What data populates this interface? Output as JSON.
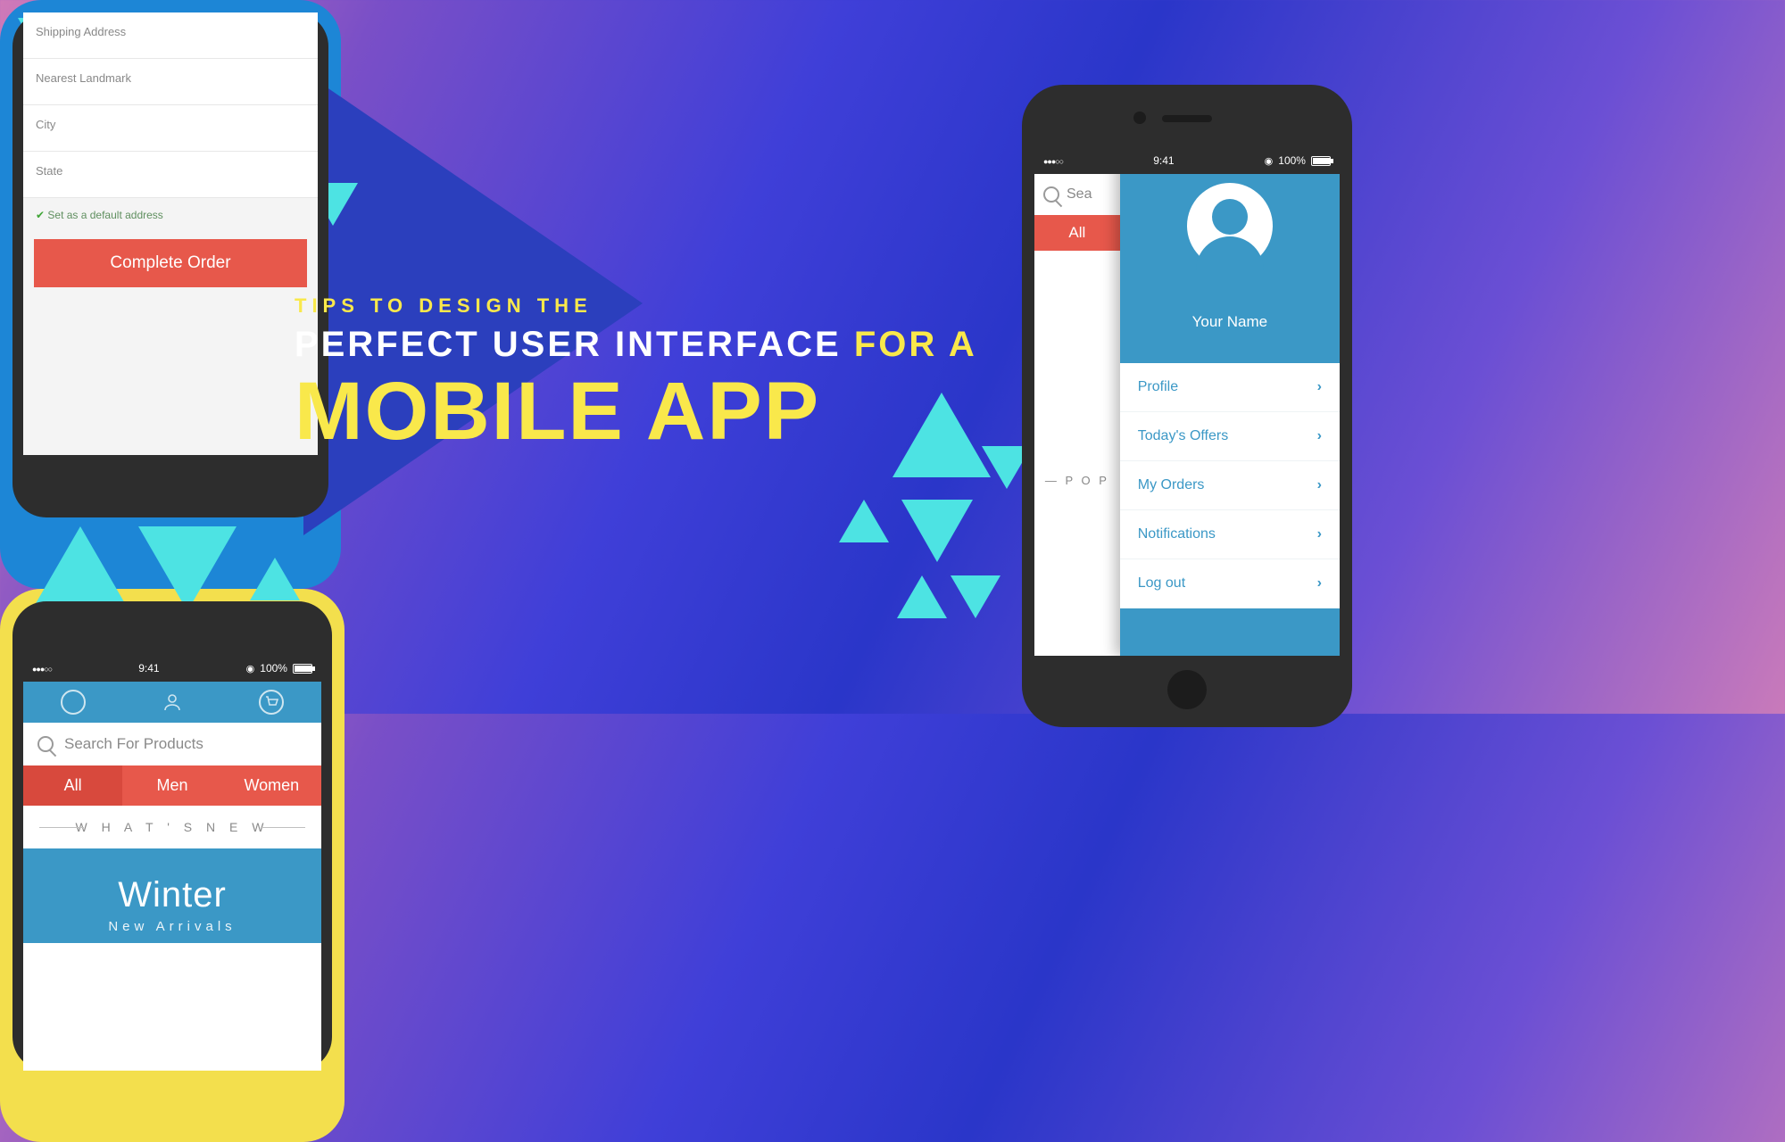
{
  "headline": {
    "kicker": "TIPS  TO  DESIGN  THE",
    "line2_a": "PERFECT  USER  INTERFACE",
    "line2_b": "FOR  A",
    "line3": "MOBILE APP"
  },
  "status": {
    "time": "9:41",
    "battery": "100%"
  },
  "phone1": {
    "search_placeholder": "Sea",
    "tab_all": "All",
    "popular": "— P O P",
    "username": "Your Name",
    "menu": [
      "Profile",
      "Today's Offers",
      "My Orders",
      "Notifications",
      "Log out"
    ]
  },
  "phone2": {
    "fields": [
      "Shipping Address",
      "Nearest Landmark",
      "City",
      "State"
    ],
    "checkbox": "Set as a default address",
    "button": "Complete Order"
  },
  "phone3": {
    "search_placeholder": "Search For Products",
    "tabs": [
      "All",
      "Men",
      "Women"
    ],
    "whats_new": "W H A T ' S   N E W",
    "hero_title": "Winter",
    "hero_sub": "New Arrivals"
  }
}
